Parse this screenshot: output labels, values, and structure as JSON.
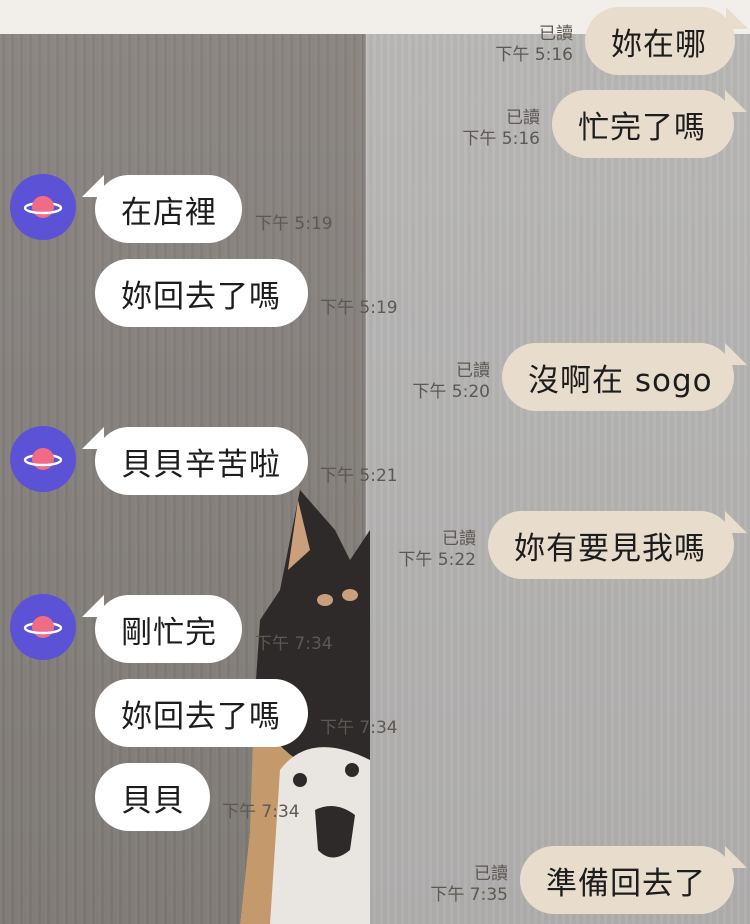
{
  "chat": {
    "read_label": "已讀",
    "avatar_icon": "planet-icon",
    "colors": {
      "incoming_bubble": "#ffffff",
      "outgoing_bubble": "#e8ddcd",
      "avatar_bg": "#5b52d6",
      "planet": "#f06b86"
    },
    "messages": [
      {
        "dir": "out",
        "text": "妳在哪",
        "time": "下午 5:16",
        "read": "已讀"
      },
      {
        "dir": "out",
        "text": "忙完了嗎",
        "time": "下午 5:16",
        "read": "已讀"
      },
      {
        "dir": "in",
        "text": "在店裡",
        "time": "下午 5:19"
      },
      {
        "dir": "in",
        "text": "妳回去了嗎",
        "time": "下午 5:19"
      },
      {
        "dir": "out",
        "text": "沒啊在 sogo",
        "time": "下午 5:20",
        "read": "已讀"
      },
      {
        "dir": "in",
        "text": "貝貝辛苦啦",
        "time": "下午 5:21"
      },
      {
        "dir": "out",
        "text": "妳有要見我嗎",
        "time": "下午 5:22",
        "read": "已讀"
      },
      {
        "dir": "in",
        "text": "剛忙完",
        "time": "下午 7:34"
      },
      {
        "dir": "in",
        "text": "妳回去了嗎",
        "time": "下午 7:34"
      },
      {
        "dir": "in",
        "text": "貝貝",
        "time": "下午 7:34"
      },
      {
        "dir": "out",
        "text": "準備回去了",
        "time": "下午 7:35",
        "read": "已讀"
      }
    ]
  }
}
